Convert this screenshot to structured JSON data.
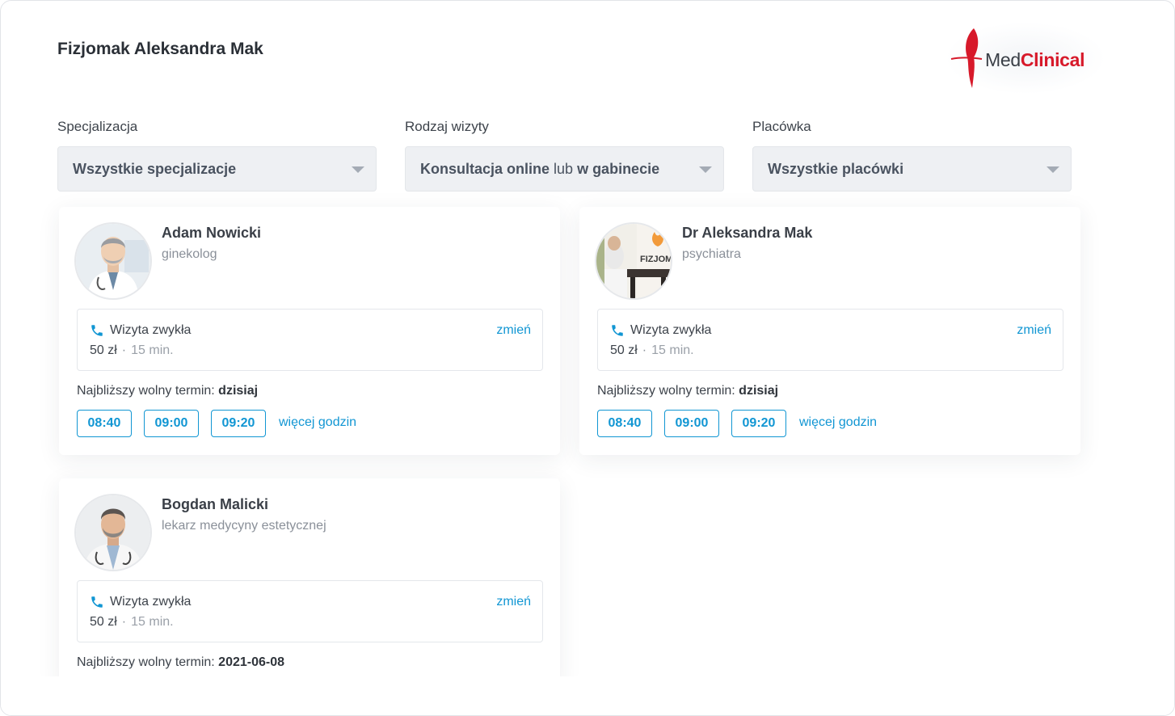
{
  "header": {
    "title": "Fizjomak Aleksandra Mak"
  },
  "logo": {
    "part1": "Med",
    "part2": "Clinical",
    "accent": "#d7192a"
  },
  "filters": {
    "specialization": {
      "label": "Specjalizacja",
      "value": "Wszystkie specjalizacje"
    },
    "visit_type": {
      "label": "Rodzaj wizyty",
      "value_bold_1": "Konsultacja online",
      "value_light": " lub ",
      "value_bold_2": "w gabinecie"
    },
    "facility": {
      "label": "Placówka",
      "value": "Wszystkie placówki"
    }
  },
  "doctors": [
    {
      "name": "Adam Nowicki",
      "specialty": "ginekolog",
      "visit": {
        "icon": "phone-icon",
        "name": "Wizyta zwykła",
        "price": "50 zł",
        "duration": "15 min.",
        "change": "zmień"
      },
      "next_label": "Najbliższy wolny termin:",
      "next_value": "dzisiaj",
      "slots": [
        "08:40",
        "09:00",
        "09:20"
      ],
      "more": "więcej godzin"
    },
    {
      "name": "Dr Aleksandra Mak",
      "specialty": "psychiatra",
      "visit": {
        "icon": "phone-icon",
        "name": "Wizyta zwykła",
        "price": "50 zł",
        "duration": "15 min.",
        "change": "zmień"
      },
      "next_label": "Najbliższy wolny termin:",
      "next_value": "dzisiaj",
      "slots": [
        "08:40",
        "09:00",
        "09:20"
      ],
      "more": "więcej godzin"
    },
    {
      "name": "Bogdan Malicki",
      "specialty": "lekarz medycyny estetycznej",
      "visit": {
        "icon": "phone-icon",
        "name": "Wizyta zwykła",
        "price": "50 zł",
        "duration": "15 min.",
        "change": "zmień"
      },
      "next_label": "Najbliższy wolny termin:",
      "next_value": "2021-06-08"
    }
  ],
  "colors": {
    "link": "#1196d3",
    "select_bg": "#eef0f3"
  }
}
